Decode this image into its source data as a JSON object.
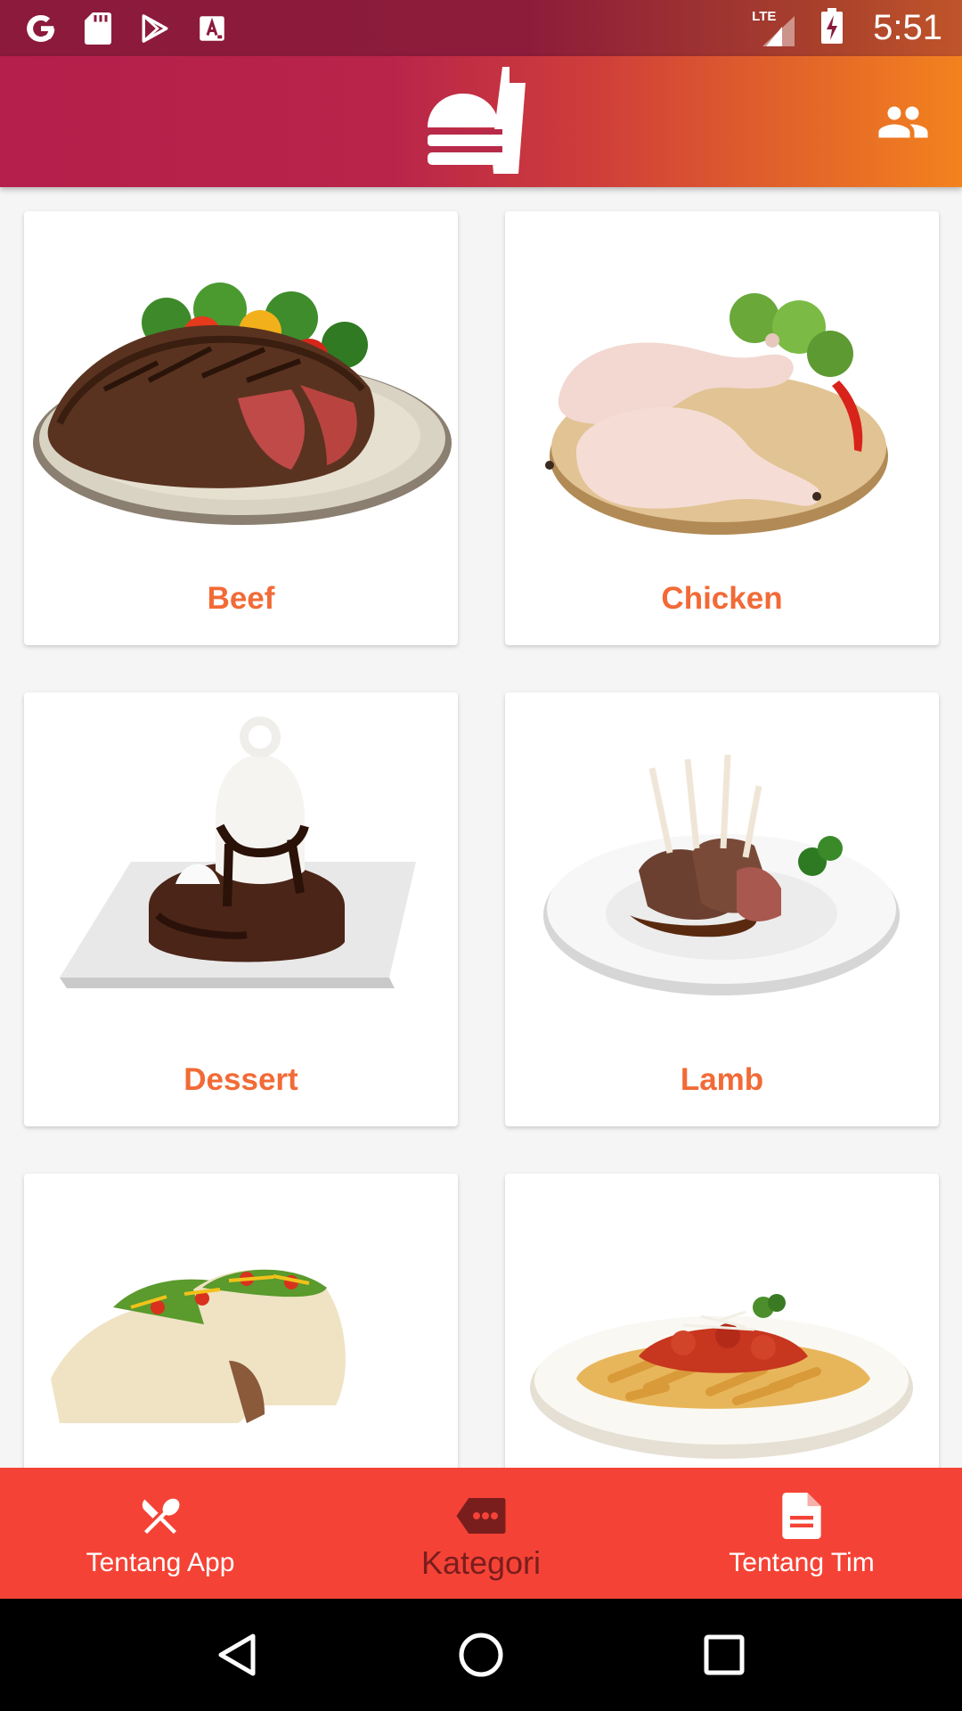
{
  "status_bar": {
    "time": "5:51",
    "network": "LTE",
    "left_icons": [
      "google-icon",
      "sd-card-icon",
      "play-store-icon",
      "text-a-icon"
    ]
  },
  "app_bar": {
    "logo": "burger-drink-logo",
    "action_icon": "people-icon"
  },
  "categories": [
    {
      "label": "Beef",
      "image": "steak-plate"
    },
    {
      "label": "Chicken",
      "image": "raw-chicken-board"
    },
    {
      "label": "Dessert",
      "image": "brownie-sundae"
    },
    {
      "label": "Lamb",
      "image": "lamb-rack-plate"
    },
    {
      "label": "",
      "image": "tacos"
    },
    {
      "label": "",
      "image": "penne-pasta"
    }
  ],
  "bottom_nav": {
    "items": [
      {
        "label": "Tentang App",
        "icon": "utensils-icon",
        "active": false
      },
      {
        "label": "Kategori",
        "icon": "tag-icon",
        "active": true
      },
      {
        "label": "Tentang Tim",
        "icon": "document-icon",
        "active": false
      }
    ]
  },
  "colors": {
    "accent_text": "#f26a36",
    "bottom_nav": "#f44336",
    "active_nav": "#7a1d1d",
    "app_bar_start": "#b41f4b",
    "app_bar_end": "#f3821e"
  }
}
